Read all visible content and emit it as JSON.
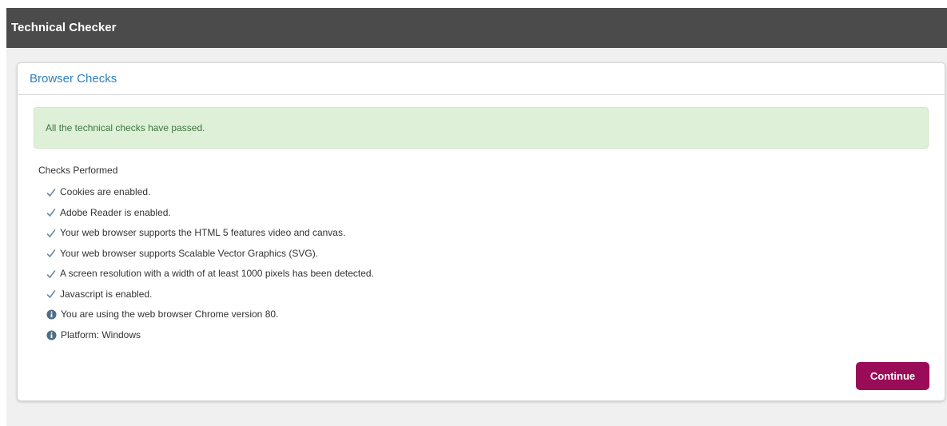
{
  "app": {
    "title": "Technical Checker"
  },
  "panel": {
    "heading": "Browser Checks",
    "alert_text": "All the technical checks have passed.",
    "checks_title": "Checks Performed",
    "checks": [
      {
        "status": "pass",
        "icon": "check-icon",
        "text": "Cookies are enabled."
      },
      {
        "status": "pass",
        "icon": "check-icon",
        "text": "Adobe Reader is enabled."
      },
      {
        "status": "pass",
        "icon": "check-icon",
        "text": "Your web browser supports the HTML 5 features video and canvas."
      },
      {
        "status": "pass",
        "icon": "check-icon",
        "text": "Your web browser supports Scalable Vector Graphics (SVG)."
      },
      {
        "status": "pass",
        "icon": "check-icon",
        "text": "A screen resolution with a width of at least 1000 pixels has been detected."
      },
      {
        "status": "pass",
        "icon": "check-icon",
        "text": "Javascript is enabled."
      },
      {
        "status": "info",
        "icon": "info-icon",
        "text": "You are using the web browser Chrome version 80."
      },
      {
        "status": "info",
        "icon": "info-icon",
        "text": "Platform: Windows"
      }
    ],
    "continue_label": "Continue"
  },
  "colors": {
    "topbar": "#4b4b4b",
    "heading": "#2f7fbf",
    "alert_bg": "#dff0d8",
    "alert_text": "#3c763d",
    "check": "#6b8aa3",
    "info": "#4f6e85",
    "button": "#9a0b58"
  }
}
